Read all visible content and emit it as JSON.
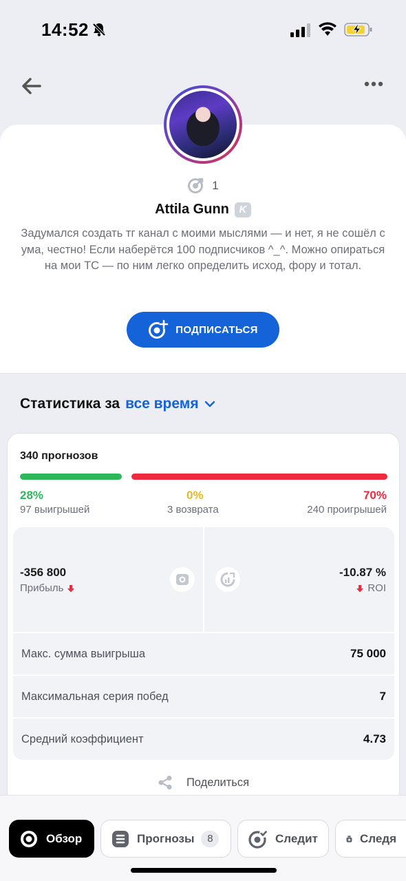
{
  "status_bar": {
    "time": "14:52"
  },
  "profile": {
    "followers": "1",
    "name": "Attila Gunn",
    "badge": "K",
    "bio": "Задумался создать тг канал с моими мыслями — и нет, я не сошёл с ума, честно! Если наберётся 100 подписчиков ^_^. Можно опираться на мои ТС — по ним легко определить исход, фору и тотал.",
    "subscribe_label": "ПОДПИСАТЬСЯ"
  },
  "stats": {
    "heading": "Статистика за",
    "period": "все время",
    "predictions": "340 прогнозов",
    "win_fraction": 0.28,
    "loss_fraction": 0.7,
    "win_pct": "28%",
    "win_label": "97 выигрышей",
    "return_pct": "0%",
    "return_label": "3 возврата",
    "loss_pct": "70%",
    "loss_label": "240 проигрышей",
    "profit_value": "-356 800",
    "profit_label": "Прибыль",
    "roi_value": "-10.87 %",
    "roi_label": "ROI",
    "rows": [
      {
        "label": "Макс. сумма выигрыша",
        "value": "75 000"
      },
      {
        "label": "Максимальная серия побед",
        "value": "7"
      },
      {
        "label": "Средний коэффициент",
        "value": "4.73"
      }
    ],
    "share_label": "Поделиться"
  },
  "tabs": [
    {
      "label": "Обзор",
      "active": true
    },
    {
      "label": "Прогнозы",
      "badge": "8"
    },
    {
      "label": "Следит"
    },
    {
      "label": "Следя"
    }
  ],
  "colors": {
    "accent": "#1463d8",
    "win": "#2cb75a",
    "loss": "#ee2b3e",
    "return": "#e8b923"
  }
}
